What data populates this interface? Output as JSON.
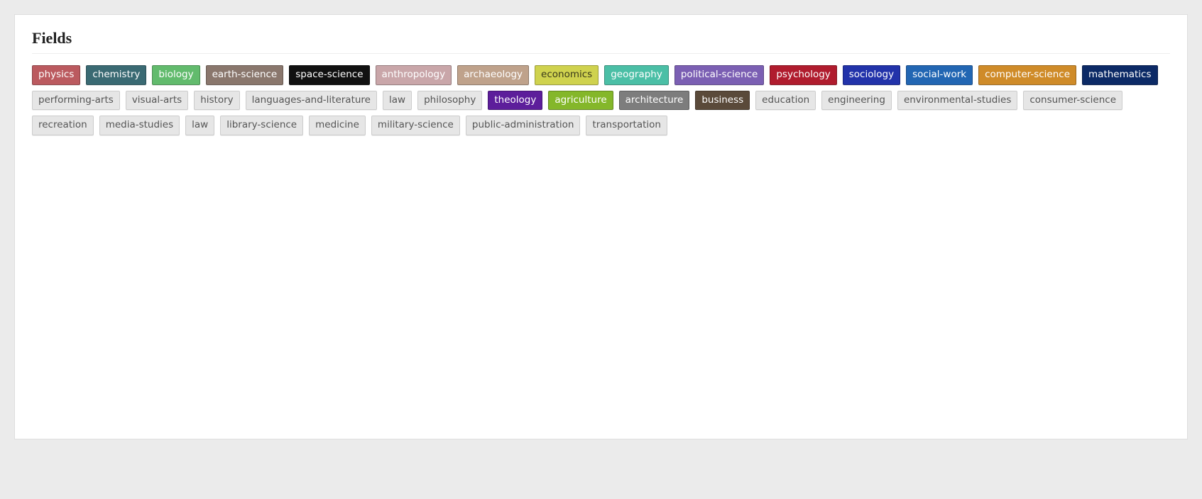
{
  "section": {
    "title": "Fields"
  },
  "fields": [
    {
      "label": "physics",
      "bg": "#bb5a5f",
      "fg": "#ffffff"
    },
    {
      "label": "chemistry",
      "bg": "#3a6a73",
      "fg": "#ffffff"
    },
    {
      "label": "biology",
      "bg": "#62bb6d",
      "fg": "#ffffff"
    },
    {
      "label": "earth-science",
      "bg": "#8a776d",
      "fg": "#ffffff"
    },
    {
      "label": "space-science",
      "bg": "#111111",
      "fg": "#ffffff"
    },
    {
      "label": "anthropology",
      "bg": "#c9a6a9",
      "fg": "#ffffff"
    },
    {
      "label": "archaeology",
      "bg": "#bfa28b",
      "fg": "#ffffff"
    },
    {
      "label": "economics",
      "bg": "#cfd24e",
      "fg": "#3a3a1a"
    },
    {
      "label": "geography",
      "bg": "#4bbfa6",
      "fg": "#ffffff"
    },
    {
      "label": "political-science",
      "bg": "#7b5fb3",
      "fg": "#ffffff"
    },
    {
      "label": "psychology",
      "bg": "#b01c2e",
      "fg": "#ffffff"
    },
    {
      "label": "sociology",
      "bg": "#2233aa",
      "fg": "#ffffff"
    },
    {
      "label": "social-work",
      "bg": "#2266b3",
      "fg": "#ffffff"
    },
    {
      "label": "computer-science",
      "bg": "#cf8b29",
      "fg": "#ffffff"
    },
    {
      "label": "mathematics",
      "bg": "#0c2a66",
      "fg": "#ffffff"
    },
    {
      "label": "performing-arts",
      "bg": null,
      "fg": null
    },
    {
      "label": "visual-arts",
      "bg": null,
      "fg": null
    },
    {
      "label": "history",
      "bg": null,
      "fg": null
    },
    {
      "label": "languages-and-literature",
      "bg": null,
      "fg": null
    },
    {
      "label": "law",
      "bg": null,
      "fg": null
    },
    {
      "label": "philosophy",
      "bg": null,
      "fg": null
    },
    {
      "label": "theology",
      "bg": "#5d1e9b",
      "fg": "#ffffff"
    },
    {
      "label": "agriculture",
      "bg": "#84b72a",
      "fg": "#ffffff"
    },
    {
      "label": "architecture",
      "bg": "#7d7d7d",
      "fg": "#ffffff"
    },
    {
      "label": "business",
      "bg": "#5a4a3a",
      "fg": "#ffffff"
    },
    {
      "label": "education",
      "bg": null,
      "fg": null
    },
    {
      "label": "engineering",
      "bg": null,
      "fg": null
    },
    {
      "label": "environmental-studies",
      "bg": null,
      "fg": null
    },
    {
      "label": "consumer-science",
      "bg": null,
      "fg": null
    },
    {
      "label": "recreation",
      "bg": null,
      "fg": null
    },
    {
      "label": "media-studies",
      "bg": null,
      "fg": null
    },
    {
      "label": "law",
      "bg": null,
      "fg": null
    },
    {
      "label": "library-science",
      "bg": null,
      "fg": null
    },
    {
      "label": "medicine",
      "bg": null,
      "fg": null
    },
    {
      "label": "military-science",
      "bg": null,
      "fg": null
    },
    {
      "label": "public-administration",
      "bg": null,
      "fg": null
    },
    {
      "label": "transportation",
      "bg": null,
      "fg": null
    }
  ]
}
